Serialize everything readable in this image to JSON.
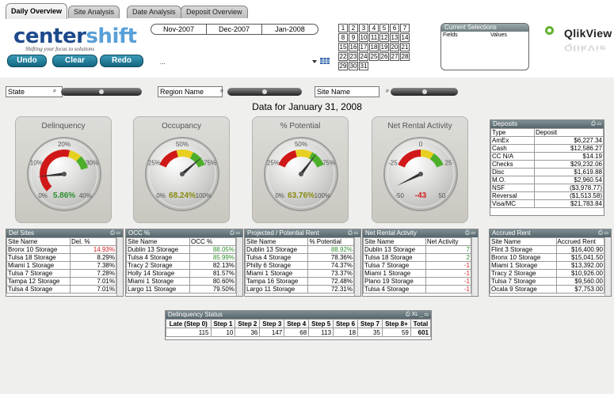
{
  "tabs": [
    {
      "label": "Daily Overview",
      "active": true
    },
    {
      "label": "Site Analysis",
      "active": false
    },
    {
      "label": "Date Analysis",
      "active": false
    },
    {
      "label": "Deposit Overview",
      "active": false
    }
  ],
  "logo": {
    "text_a": "center",
    "text_b": "shift",
    "tagline": "Shifting your focus to solutions"
  },
  "buttons": {
    "undo": "Undo",
    "clear": "Clear",
    "redo": "Redo"
  },
  "periods": [
    "Nov-2007",
    "Dec-2007",
    "Jan-2008"
  ],
  "more": "...",
  "calendar": [
    [
      "1",
      "2",
      "3",
      "4",
      "5",
      "6",
      "7"
    ],
    [
      "8",
      "9",
      "10",
      "11",
      "12",
      "13",
      "14"
    ],
    [
      "15",
      "16",
      "17",
      "18",
      "19",
      "20",
      "21"
    ],
    [
      "22",
      "23",
      "24",
      "25",
      "26",
      "27",
      "28"
    ],
    [
      "29",
      "30",
      "31"
    ]
  ],
  "current_selections": {
    "title": "Current Selections",
    "col_fields": "Fields",
    "col_values": "Values"
  },
  "brand": "QlikView",
  "filters": {
    "state": "State",
    "region": "Region Name",
    "site": "Site Name"
  },
  "data_title": "Data for January 31, 2008",
  "gauges": [
    {
      "title": "Delinquency",
      "value": "5.86%",
      "ticks": [
        "0%",
        "10%",
        "20%",
        "30%",
        "40%"
      ],
      "fraction": 0.1465,
      "value_color": "#2e8f2e"
    },
    {
      "title": "Occupancy",
      "value": "68.24%",
      "ticks": [
        "0%",
        "25%",
        "50%",
        "75%",
        "100%"
      ],
      "fraction": 0.6824,
      "value_color": "#8a8a10"
    },
    {
      "title": "% Potential",
      "value": "63.76%",
      "ticks": [
        "0%",
        "25%",
        "50%",
        "75%",
        "100%"
      ],
      "fraction": 0.6376,
      "value_color": "#8a8a10"
    },
    {
      "title": "Net Rental Activity",
      "value": "-43",
      "ticks": [
        "-50",
        "-25",
        "0",
        "25",
        "50"
      ],
      "fraction": 0.07,
      "value_color": "#d02020"
    }
  ],
  "deposits": {
    "title": "Deposits",
    "col_type": "Type",
    "col_deposit": "Deposit",
    "rows": [
      [
        "AmEx",
        "$6,227.34"
      ],
      [
        "Cash",
        "$12,586.27"
      ],
      [
        "CC N/A",
        "$14.19"
      ],
      [
        "Checks",
        "$29,232.06"
      ],
      [
        "Disc",
        "$1,619.88"
      ],
      [
        "M.O.",
        "$2,960.54"
      ],
      [
        "NSF",
        "($3,978.77)"
      ],
      [
        "Reversal",
        "($1,513.58)"
      ],
      [
        "Visa/MC",
        "$21,783.84"
      ]
    ]
  },
  "tables": [
    {
      "title": "Del Sites",
      "col1": "Site Name",
      "col2": "Del. %",
      "rows": [
        [
          "Bronx 10 Storage",
          "14.93%",
          "#d02020"
        ],
        [
          "Tulsa 18 Storage",
          "8.29%",
          ""
        ],
        [
          "Miami 1 Storage",
          "7.38%",
          ""
        ],
        [
          "Tulsa 7 Storage",
          "7.28%",
          ""
        ],
        [
          "Tampa 12 Storage",
          "7.01%",
          ""
        ],
        [
          "Tulsa 4 Storage",
          "7.01%",
          ""
        ]
      ]
    },
    {
      "title": "OCC %",
      "col1": "Site Name",
      "col2": "OCC %",
      "rows": [
        [
          "Dublin 13 Storage",
          "88.05%",
          "#2e8f2e"
        ],
        [
          "Tulsa 4 Storage",
          "85.99%",
          "#2e8f2e"
        ],
        [
          "Tracy 2 Storage",
          "82.13%",
          ""
        ],
        [
          "Holly 14 Storage",
          "81.57%",
          ""
        ],
        [
          "Miami 1 Storage",
          "80.60%",
          ""
        ],
        [
          "Largo 11 Storage",
          "79.50%",
          ""
        ]
      ]
    },
    {
      "title": "Projected / Potential Rent",
      "col1": "Site Name",
      "col2": "% Potential",
      "rows": [
        [
          "Dublin 13 Storage",
          "88.92%",
          "#2e8f2e"
        ],
        [
          "Tulsa 4 Storage",
          "78.36%",
          ""
        ],
        [
          "Philly 6 Storage",
          "74.37%",
          ""
        ],
        [
          "Miami 1 Storage",
          "73.37%",
          ""
        ],
        [
          "Tampa 16 Storage",
          "72.48%",
          ""
        ],
        [
          "Largo 11 Storage",
          "72.31%",
          ""
        ]
      ]
    },
    {
      "title": "Net Rental Activity",
      "col1": "Site Name",
      "col2": "Net Activity",
      "rows": [
        [
          "Dublin 13 Storage",
          "7",
          "#2e8f2e"
        ],
        [
          "Tulsa 18 Storage",
          "2",
          "#2e8f2e"
        ],
        [
          "Tulsa 7 Storage",
          "-1",
          "#d02020"
        ],
        [
          "Miami 1 Storage",
          "-1",
          "#d02020"
        ],
        [
          "Plano 19 Storage",
          "-1",
          "#d02020"
        ],
        [
          "Tulsa 4 Storage",
          "-1",
          "#d02020"
        ]
      ]
    },
    {
      "title": "Accrued Rent",
      "col1": "Site Name",
      "col2": "Accrued Rent",
      "rows": [
        [
          "Flint 3 Storage",
          "$16,400.90",
          ""
        ],
        [
          "Bronx 10 Storage",
          "$15,041.50",
          ""
        ],
        [
          "Miami 1 Storage",
          "$13,392.00",
          ""
        ],
        [
          "Tracy 2 Storage",
          "$10,926.00",
          ""
        ],
        [
          "Tulsa 7 Storage",
          "$9,560.00",
          ""
        ],
        [
          "Ocala 9 Storage",
          "$7,753.00",
          ""
        ]
      ]
    }
  ],
  "delinquency_status": {
    "title": "Delinquency Status",
    "headers": [
      "Late (Step 0)",
      "Step 1",
      "Step 2",
      "Step 3",
      "Step 4",
      "Step 5",
      "Step 6",
      "Step 7",
      "Step 8+",
      "Total"
    ],
    "values": [
      "115",
      "10",
      "36",
      "147",
      "68",
      "113",
      "18",
      "35",
      "59",
      "601"
    ]
  }
}
